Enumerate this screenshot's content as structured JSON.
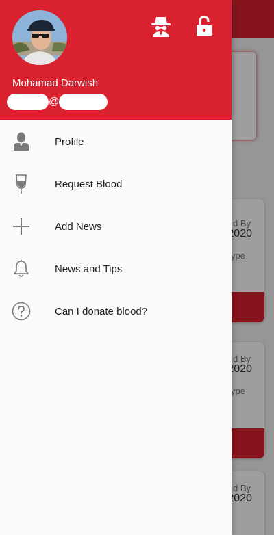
{
  "drawer": {
    "user_name": "Mohamad Darwish",
    "email_at": "@",
    "header_icons": [
      "incognito-icon",
      "lock-open-icon"
    ],
    "items": [
      {
        "label": "Profile",
        "icon": "person-icon"
      },
      {
        "label": "Request Blood",
        "icon": "blood-bag-icon"
      },
      {
        "label": "Add News",
        "icon": "plus-icon"
      },
      {
        "label": "News and Tips",
        "icon": "bell-icon"
      },
      {
        "label": "Can I donate blood?",
        "icon": "help-circle-icon"
      }
    ]
  },
  "background": {
    "cards": [
      {
        "label": "d By",
        "year": "2020",
        "type": "Type"
      },
      {
        "label": "d By",
        "year": "2020",
        "type": "Type"
      },
      {
        "label": "d By",
        "year": "2020"
      }
    ]
  },
  "colors": {
    "primary": "#d9212f",
    "drawer_bg": "#fafafa",
    "icon_gray": "#777777"
  }
}
